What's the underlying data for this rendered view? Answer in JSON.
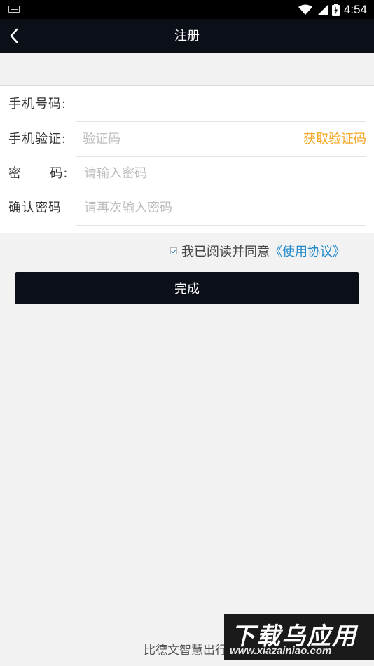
{
  "status_bar": {
    "time": "4:54"
  },
  "app_bar": {
    "title": "注册",
    "back_icon": "chevron-left-icon"
  },
  "form": {
    "phone_label": "手机号码:",
    "phone_value": "",
    "verify_label": "手机验证:",
    "verify_placeholder": "验证码",
    "get_code_label": "获取验证码",
    "password_label": "密      码:",
    "password_placeholder": "请输入密码",
    "confirm_label": "确认密码",
    "confirm_placeholder": "请再次输入密码"
  },
  "agreement": {
    "checked": true,
    "text": "我已阅读并同意",
    "link": "《使用协议》"
  },
  "done_button": "完成",
  "footer": "比德文智慧出行",
  "watermark": {
    "title": "下载乌应用",
    "url": "www.xiazainiao.com"
  },
  "colors": {
    "dark": "#0b0f18",
    "accent_orange": "#f5a623",
    "link_blue": "#1e88c8",
    "background": "#f2f2f2"
  }
}
